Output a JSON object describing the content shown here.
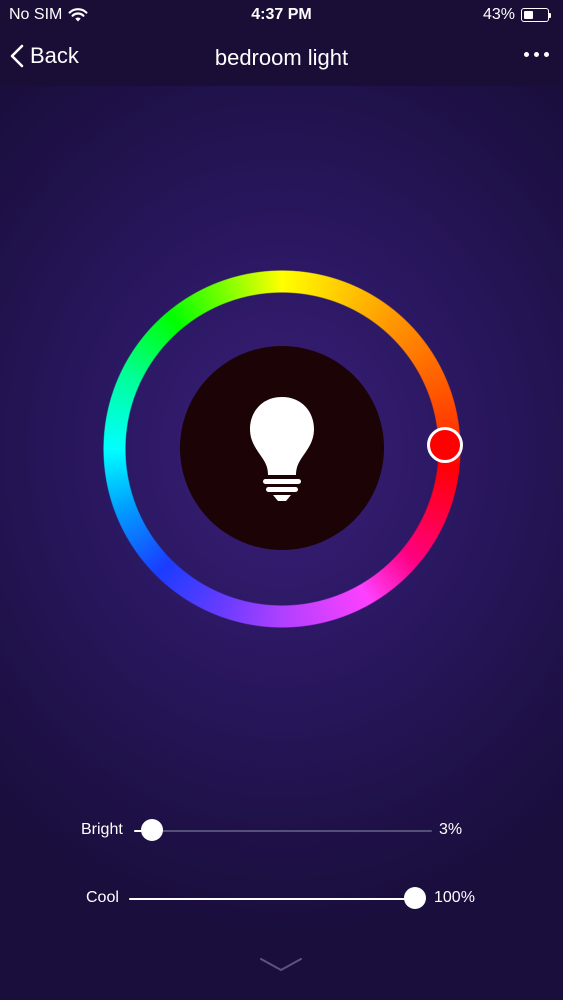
{
  "status_bar": {
    "carrier": "No SIM",
    "time": "4:37 PM",
    "battery_percent": "43%",
    "battery_level": 0.43
  },
  "nav": {
    "back_label": "Back",
    "title": "bedroom light"
  },
  "color_wheel": {
    "selected_color": "#ff0000"
  },
  "sliders": {
    "bright": {
      "label": "Bright",
      "value": "3%",
      "level": 0.03
    },
    "cool": {
      "label": "Cool",
      "value": "100%",
      "level": 1.0
    }
  },
  "theme": {
    "background": "#24135a",
    "bulb_bg": "#1c0306"
  }
}
